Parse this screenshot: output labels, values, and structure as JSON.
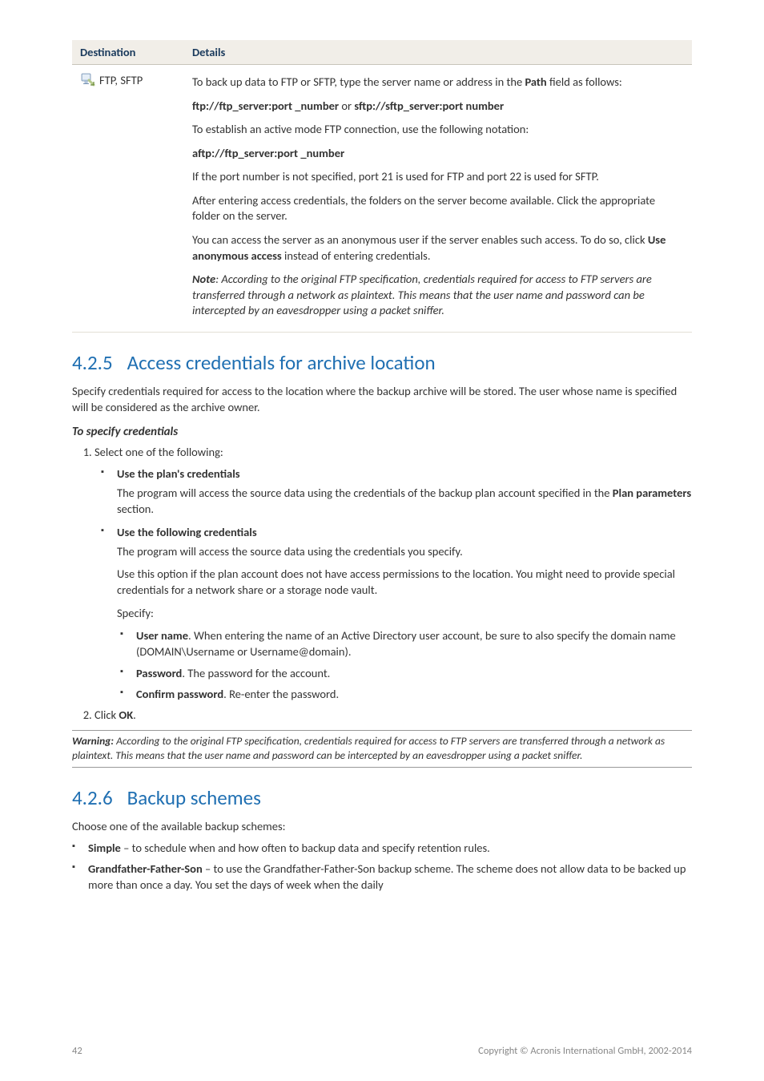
{
  "table": {
    "header": {
      "c1": "Destination",
      "c2": "Details"
    },
    "row": {
      "dest": "FTP, SFTP",
      "p1a": "To back up data to FTP or SFTP, type the server name or address in the ",
      "p1b": "Path",
      "p1c": " field as follows:",
      "p2a": "ftp://ftp_server:port _number",
      "p2b": " or ",
      "p2c": "sftp://sftp_server:port number",
      "p3": "To establish an active mode FTP connection, use the following notation:",
      "p4": "aftp://ftp_server:port _number",
      "p5": "If the port number is not specified, port 21 is used for FTP and port 22 is used for SFTP.",
      "p6": "After entering access credentials, the folders on the server become available. Click the appropriate folder on the server.",
      "p7a": "You can access the server as an anonymous user if the server enables such access. To do so, click ",
      "p7b": "Use anonymous access",
      "p7c": " instead of entering credentials.",
      "p8a": "Note",
      "p8b": ": According to the original FTP specification, credentials required for access to FTP servers are transferred through a network as plaintext. This means that the user name and password can be intercepted by an eavesdropper using a packet sniffer."
    }
  },
  "sec425": {
    "num": "4.2.5",
    "title": "Access credentials for archive location",
    "intro": "Specify credentials required for access to the location where the backup archive will be stored. The user whose name is specified will be considered as the archive owner.",
    "subhead": "To specify credentials",
    "step1": "Select one of the following:",
    "opt1": "Use the plan's credentials",
    "opt1_desc_a": "The program will access the source data using the credentials of the backup plan account specified in the ",
    "opt1_desc_b": "Plan parameters",
    "opt1_desc_c": " section.",
    "opt2": "Use the following credentials",
    "opt2_desc1": "The program will access the source data using the credentials you specify.",
    "opt2_desc2": "Use this option if the plan account does not have access permissions to the location. You might need to provide special credentials for a network share or a storage node vault.",
    "opt2_desc3": "Specify:",
    "sub1a": "User name",
    "sub1b": ". When entering the name of an Active Directory user account, be sure to also specify the domain name (DOMAIN\\Username or Username@domain).",
    "sub2a": "Password",
    "sub2b": ". The password for the account.",
    "sub3a": "Confirm password",
    "sub3b": ". Re-enter the password.",
    "step2a": "Click ",
    "step2b": "OK",
    "step2c": ".",
    "warning_a": "Warning:",
    "warning_b": " According to the original FTP specification, credentials required for access to FTP servers are transferred through a network as plaintext. This means that the user name and password can be intercepted by an eavesdropper using a packet sniffer."
  },
  "sec426": {
    "num": "4.2.6",
    "title": "Backup schemes",
    "intro": "Choose one of the available backup schemes:",
    "b1a": "Simple",
    "b1b": " – to schedule when and how often to backup data and specify retention rules.",
    "b2a": "Grandfather-Father-Son",
    "b2b": " – to use the Grandfather-Father-Son backup scheme. The scheme does not allow data to be backed up more than once a day. You set the days of week when the daily"
  },
  "footer": {
    "page": "42",
    "copyright": "Copyright © Acronis International GmbH, 2002-2014"
  }
}
